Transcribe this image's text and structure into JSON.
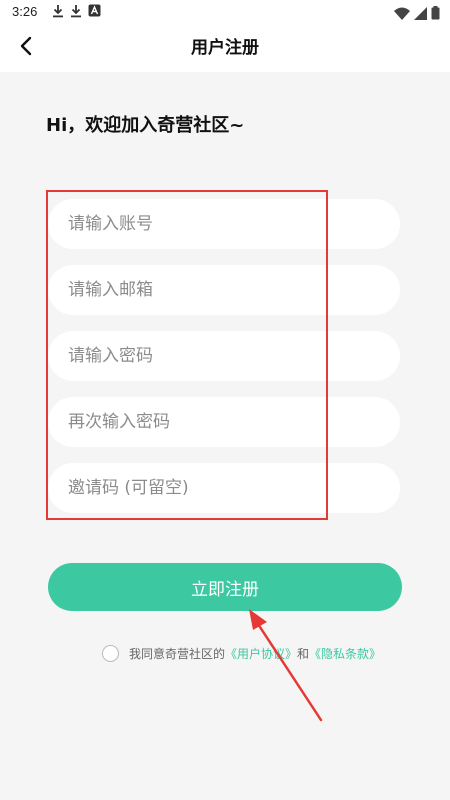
{
  "status_bar": {
    "time": "3:26",
    "left_icons": [
      "download-icon",
      "download-icon",
      "app-notification-icon"
    ],
    "right_icons": [
      "wifi-icon",
      "signal-icon",
      "battery-icon"
    ]
  },
  "header": {
    "title": "用户注册",
    "back_icon": "back-arrow-icon"
  },
  "greeting": "Hi，欢迎加入奇营社区~",
  "form": {
    "fields": [
      {
        "placeholder": "请输入账号"
      },
      {
        "placeholder": "请输入邮箱"
      },
      {
        "placeholder": "请输入密码"
      },
      {
        "placeholder": "再次输入密码"
      },
      {
        "placeholder": "邀请码 (可留空)"
      }
    ]
  },
  "register_button": "立即注册",
  "agreement": {
    "prefix": "我同意奇营社区的",
    "user_agreement": "《用户协议》",
    "joiner": "和",
    "privacy_policy": "《隐私条款》"
  },
  "colors": {
    "accent": "#3cc8a0",
    "annotation": "#e53935",
    "background": "#f5f5f5"
  }
}
